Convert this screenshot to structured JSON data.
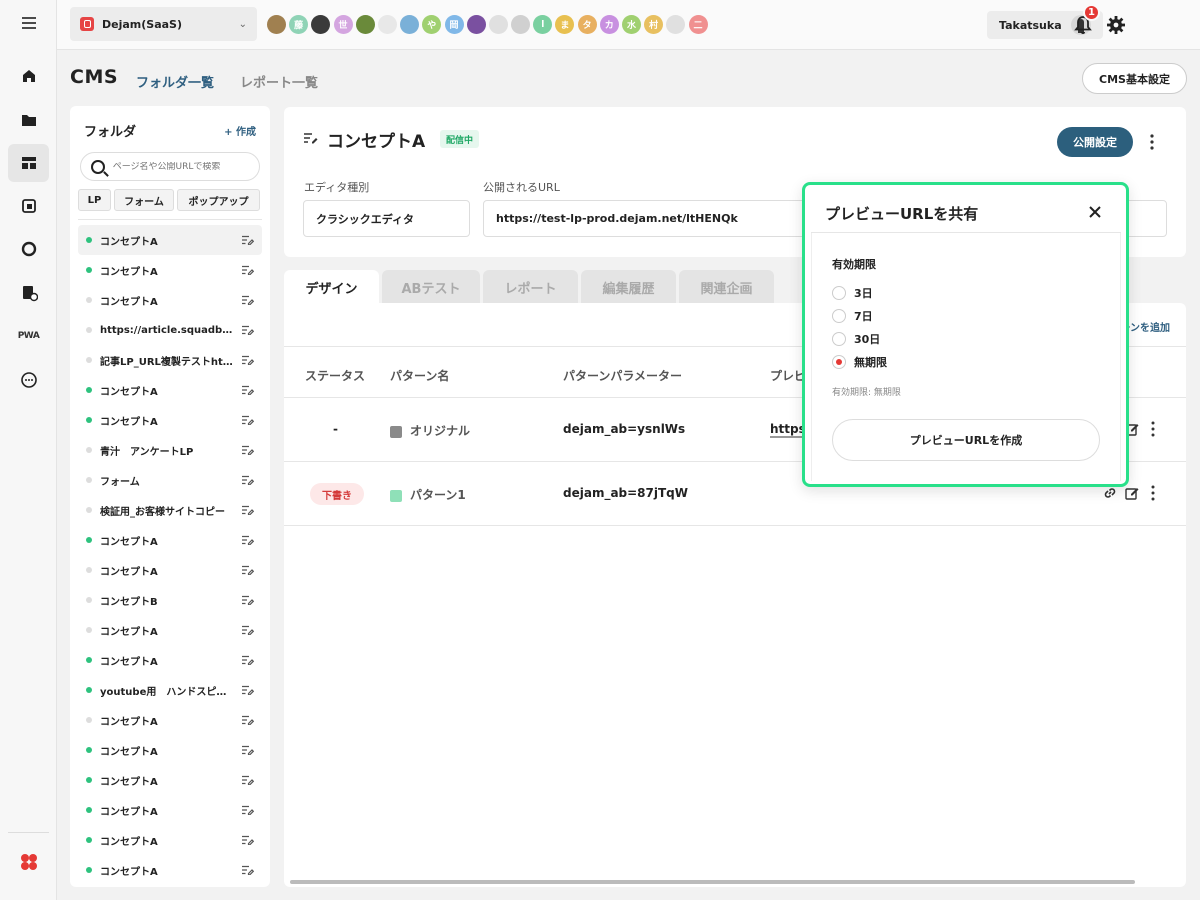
{
  "workspace": {
    "name": "Dejam(SaaS)"
  },
  "avatars": [
    {
      "label": "",
      "color": "#a08050"
    },
    {
      "label": "藤",
      "color": "#8fd3b6"
    },
    {
      "label": "",
      "color": "#3a3a3a"
    },
    {
      "label": "世",
      "color": "#d4a5e0"
    },
    {
      "label": "",
      "color": "#6a8a3a"
    },
    {
      "label": "",
      "color": "#e8e8e8"
    },
    {
      "label": "",
      "color": "#7ab0d8"
    },
    {
      "label": "や",
      "color": "#a0d070"
    },
    {
      "label": "岡",
      "color": "#80b8e8"
    },
    {
      "label": "",
      "color": "#7a50a0"
    },
    {
      "label": "",
      "color": "#e0e0e0"
    },
    {
      "label": "",
      "color": "#d0d0d0"
    },
    {
      "label": "l",
      "color": "#7ad0a0"
    },
    {
      "label": "ま",
      "color": "#e8c050"
    },
    {
      "label": "タ",
      "color": "#e8b060"
    },
    {
      "label": "カ",
      "color": "#c890e0"
    },
    {
      "label": "水",
      "color": "#a0d070"
    },
    {
      "label": "村",
      "color": "#e8c060"
    },
    {
      "label": "",
      "color": "#e0e0e0"
    },
    {
      "label": "二",
      "color": "#f09090"
    }
  ],
  "user": {
    "name": "Takatsuka"
  },
  "notifications": {
    "count": "1"
  },
  "header": {
    "app_title": "CMS",
    "tab_folders": "フォルダ一覧",
    "tab_reports": "レポート一覧",
    "settings_button": "CMS基本設定"
  },
  "rail": {
    "pwa_label": "PWA"
  },
  "folder_panel": {
    "title": "フォルダ",
    "create_label": "+ 作成",
    "search_placeholder": "ページ名や公開URLで検索",
    "filter_tabs": [
      "LP",
      "フォーム",
      "ポップアップ"
    ],
    "items": [
      {
        "label": "コンセプトA",
        "live": true
      },
      {
        "label": "コンセプトA",
        "live": true
      },
      {
        "label": "コンセプトA",
        "live": false
      },
      {
        "label": "https://article.squadbeyond...",
        "live": false
      },
      {
        "label": "記事LP_URL複製テストhttps",
        "live": false
      },
      {
        "label": "コンセプトA",
        "live": true
      },
      {
        "label": "コンセプトA",
        "live": true
      },
      {
        "label": "青汁　アンケートLP",
        "live": false
      },
      {
        "label": "フォーム",
        "live": false
      },
      {
        "label": "検証用_お客様サイトコピー",
        "live": false
      },
      {
        "label": "コンセプトA",
        "live": true
      },
      {
        "label": "コンセプトA",
        "live": false
      },
      {
        "label": "コンセプトB",
        "live": false
      },
      {
        "label": "コンセプトA",
        "live": false
      },
      {
        "label": "コンセプトA",
        "live": true
      },
      {
        "label": "youtube用　ハンドスピナー",
        "live": true
      },
      {
        "label": "コンセプトA",
        "live": false
      },
      {
        "label": "コンセプトA",
        "live": true
      },
      {
        "label": "コンセプトA",
        "live": true
      },
      {
        "label": "コンセプトA",
        "live": true
      },
      {
        "label": "コンセプトA",
        "live": true
      },
      {
        "label": "コンセプトA",
        "live": true
      }
    ]
  },
  "page": {
    "title": "コンセプトA",
    "status": "配信中",
    "publish_button": "公開設定",
    "editor_label": "エディタ種別",
    "editor_value": "クラシックエディタ",
    "url_label": "公開されるURL",
    "url_value": "https://test-lp-prod.dejam.net/ltHENQk"
  },
  "tabs": [
    "デザイン",
    "ABテスト",
    "レポート",
    "編集履歴",
    "関連企画"
  ],
  "patterns": {
    "add_label": "ーンを追加",
    "columns": [
      "ステータス",
      "パターン名",
      "パターンパラメーター",
      "プレビ"
    ],
    "rows": [
      {
        "status": "-",
        "name": "オリジナル",
        "swatch": "#8a8a8a",
        "param": "dejam_ab=ysnlWs",
        "preview": "https:"
      },
      {
        "status": "下書き",
        "name": "パターン1",
        "swatch": "#8fe0b8",
        "param": "dejam_ab=87jTqW",
        "preview": ""
      }
    ]
  },
  "modal": {
    "title": "プレビューURLを共有",
    "expiry_label": "有効期限",
    "options": [
      "3日",
      "7日",
      "30日",
      "無期限"
    ],
    "selected": "無期限",
    "note": "有効期限: 無期限",
    "create_button": "プレビューURLを作成",
    "accent": "#29e08a"
  }
}
